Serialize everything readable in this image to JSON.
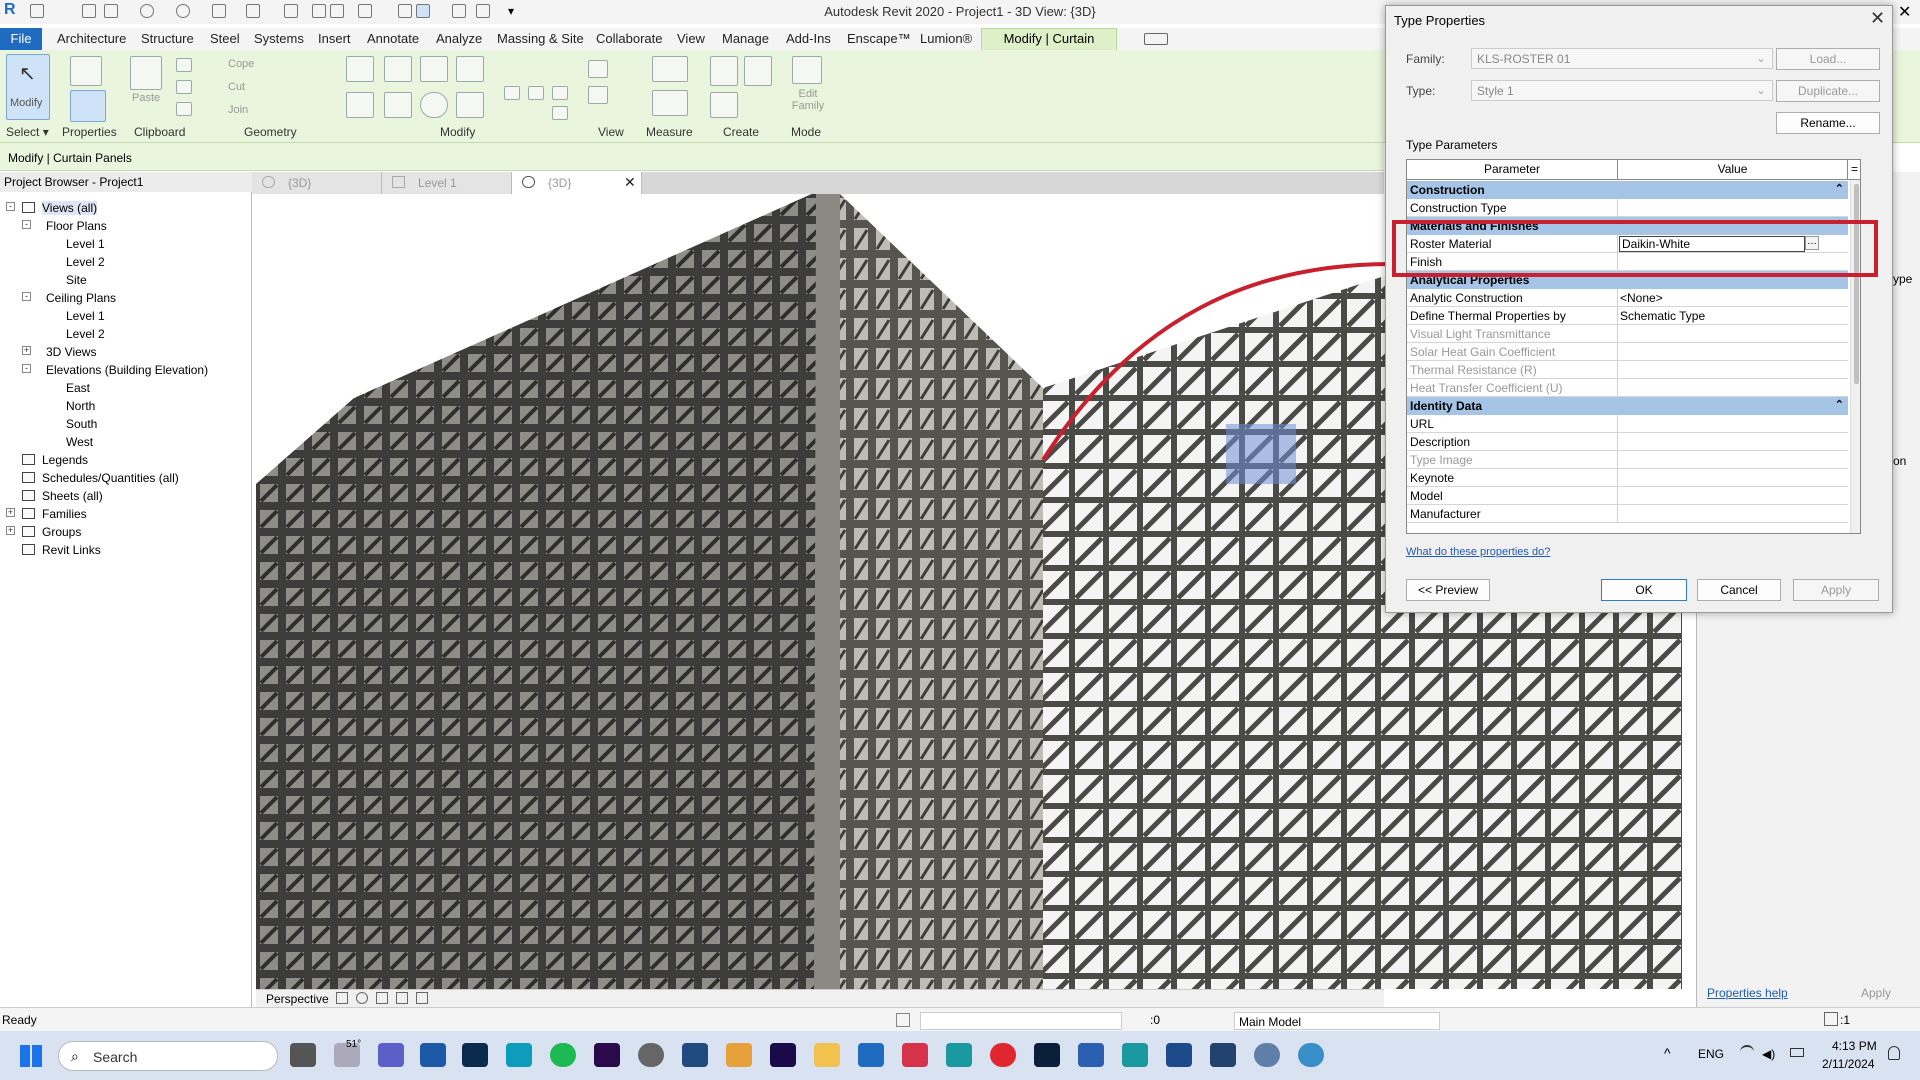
{
  "app": {
    "title": "Autodesk Revit 2020 - Project1 - 3D View: {3D}"
  },
  "menu": {
    "tabs": [
      "File",
      "Architecture",
      "Structure",
      "Steel",
      "Systems",
      "Insert",
      "Annotate",
      "Analyze",
      "Massing & Site",
      "Collaborate",
      "View",
      "Manage",
      "Add-Ins",
      "Enscape™",
      "Lumion®",
      "Modify | Curtain Panels"
    ]
  },
  "ribbon": {
    "groups": [
      "Select",
      "Properties",
      "Clipboard",
      "Geometry",
      "Modify",
      "View",
      "Measure",
      "Create",
      "Mode"
    ],
    "modify_label": "Modify",
    "paste_label": "Paste",
    "cope_label": "Cope",
    "cut_label": "Cut",
    "join_label": "Join",
    "edit_family_label": "Edit Family"
  },
  "context_bar": {
    "label": "Modify | Curtain Panels"
  },
  "project_browser": {
    "title": "Project Browser - Project1",
    "items": [
      {
        "label": "Views (all)",
        "level": 0,
        "toggle": "-"
      },
      {
        "label": "Floor Plans",
        "level": 1,
        "toggle": "-"
      },
      {
        "label": "Level 1",
        "level": 2
      },
      {
        "label": "Level 2",
        "level": 2
      },
      {
        "label": "Site",
        "level": 2
      },
      {
        "label": "Ceiling Plans",
        "level": 1,
        "toggle": "-"
      },
      {
        "label": "Level 1",
        "level": 2
      },
      {
        "label": "Level 2",
        "level": 2
      },
      {
        "label": "3D Views",
        "level": 1,
        "toggle": "+"
      },
      {
        "label": "Elevations (Building Elevation)",
        "level": 1,
        "toggle": "-"
      },
      {
        "label": "East",
        "level": 2
      },
      {
        "label": "North",
        "level": 2
      },
      {
        "label": "South",
        "level": 2
      },
      {
        "label": "West",
        "level": 2
      },
      {
        "label": "Legends",
        "level": 0
      },
      {
        "label": "Schedules/Quantities (all)",
        "level": 0
      },
      {
        "label": "Sheets (all)",
        "level": 0
      },
      {
        "label": "Families",
        "level": 0,
        "toggle": "+"
      },
      {
        "label": "Groups",
        "level": 0,
        "toggle": "+"
      },
      {
        "label": "Revit Links",
        "level": 0
      }
    ]
  },
  "view_tabs": [
    "{3D}",
    "Level 1",
    "{3D}"
  ],
  "view_bar": {
    "mode": "Perspective"
  },
  "properties_panel": {
    "help": "Properties help",
    "apply": "Apply",
    "fragments": [
      "ype",
      "on"
    ]
  },
  "status_bar": {
    "ready": "Ready",
    "zero": ":0",
    "model": "Main Model",
    "filter": ":1"
  },
  "taskbar": {
    "search": "Search",
    "lang": "ENG",
    "time": "4:13 PM",
    "date": "2/11/2024",
    "temp": "51°"
  },
  "dialog": {
    "title": "Type Properties",
    "family_label": "Family:",
    "family_value": "KLS-ROSTER 01",
    "type_label": "Type:",
    "type_value": "Style 1",
    "load": "Load...",
    "duplicate": "Duplicate...",
    "rename": "Rename...",
    "type_params": "Type Parameters",
    "col_param": "Parameter",
    "col_value": "Value",
    "col_extra": "=",
    "sections": [
      {
        "name": "Construction",
        "rows": [
          {
            "p": "Construction Type",
            "v": "",
            "grey": false
          }
        ]
      },
      {
        "name": "Materials and Finishes",
        "rows": [
          {
            "p": "Roster Material",
            "v": "Daikin-White",
            "grey": false
          },
          {
            "p": "Finish",
            "v": "",
            "grey": false
          }
        ]
      },
      {
        "name": "Analytical Properties",
        "rows": [
          {
            "p": "Analytic Construction",
            "v": "<None>",
            "grey": false
          },
          {
            "p": "Define Thermal Properties by",
            "v": "Schematic Type",
            "grey": false
          },
          {
            "p": "Visual Light Transmittance",
            "v": "",
            "grey": true
          },
          {
            "p": "Solar Heat Gain Coefficient",
            "v": "",
            "grey": true
          },
          {
            "p": "Thermal Resistance (R)",
            "v": "",
            "grey": true
          },
          {
            "p": "Heat Transfer Coefficient (U)",
            "v": "",
            "grey": true
          }
        ]
      },
      {
        "name": "Identity Data",
        "rows": [
          {
            "p": "URL",
            "v": "",
            "grey": false
          },
          {
            "p": "Description",
            "v": "",
            "grey": false
          },
          {
            "p": "Type Image",
            "v": "",
            "grey": true
          },
          {
            "p": "Keynote",
            "v": "",
            "grey": false
          },
          {
            "p": "Model",
            "v": "",
            "grey": false
          },
          {
            "p": "Manufacturer",
            "v": "",
            "grey": false
          }
        ]
      }
    ],
    "help_link": "What do these properties do?",
    "preview": "<< Preview",
    "ok": "OK",
    "cancel": "Cancel",
    "apply": "Apply"
  },
  "colors": {
    "ribbon_bg": "#e9f5dc",
    "file_tab": "#1f6bbf",
    "section_header": "#a5c4e6",
    "highlight": "#c8202f"
  }
}
